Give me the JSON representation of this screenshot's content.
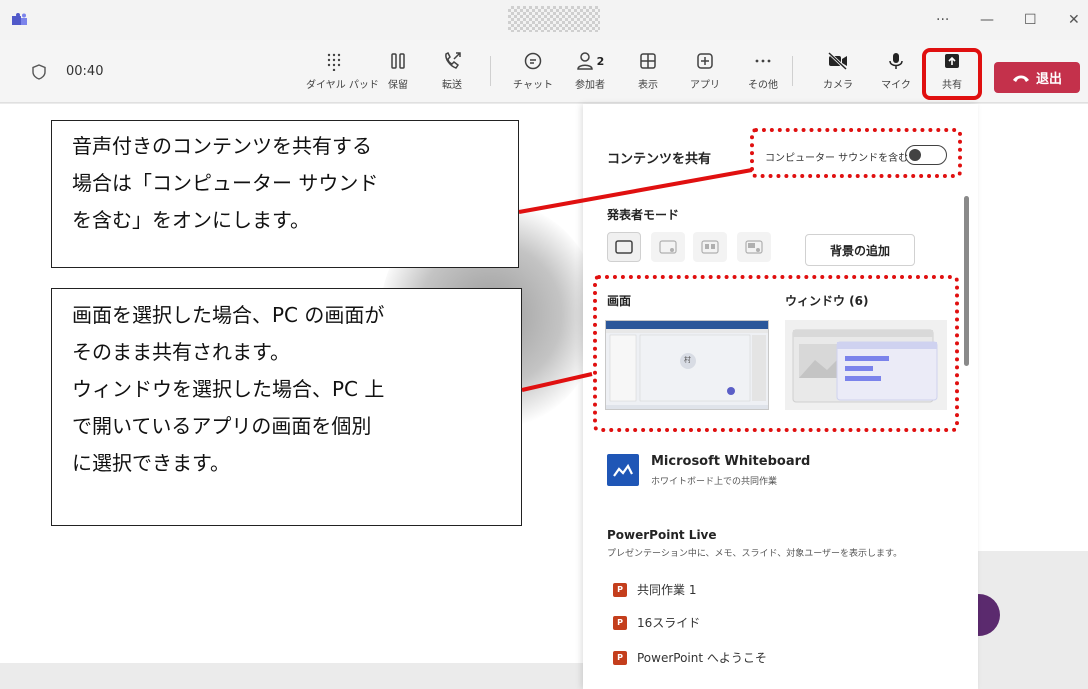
{
  "window": {
    "more_glyph": "···",
    "minimize_glyph": "—",
    "maximize_glyph": "☐",
    "close_glyph": "✕"
  },
  "toolbar": {
    "timer": "00:40",
    "dialpad": "ダイヤル パッド",
    "hold": "保留",
    "transfer": "転送",
    "chat": "チャット",
    "participants": "参加者",
    "participants_count": "2",
    "view": "表示",
    "apps": "アプリ",
    "more": "その他",
    "camera": "カメラ",
    "mic": "マイク",
    "share": "共有",
    "leave": "退出"
  },
  "callouts": {
    "sound": [
      "音声付きのコンテンツを共有する",
      "場合は「コンピューター サウンド",
      "を含む」をオンにします。"
    ],
    "screen": [
      "画面を選択した場合、PC の画面が",
      "そのまま共有されます。",
      "ウィンドウを選択した場合、PC 上",
      "で開いているアプリの画面を個別",
      "に選択できます。"
    ]
  },
  "share_panel": {
    "title": "コンテンツを共有",
    "include_sound": "コンピューター サウンドを含む",
    "include_sound_on": false,
    "presenter_mode": "発表者モード",
    "add_background": "背景の追加",
    "screen": "画面",
    "window": "ウィンドウ (6)",
    "screen_thumb_avatar": "村",
    "whiteboard_title": "Microsoft Whiteboard",
    "whiteboard_sub": "ホワイトボード上での共同作業",
    "ppt_title": "PowerPoint Live",
    "ppt_sub": "プレゼンテーション中に、メモ、スライド、対象ユーザーを表示します。",
    "ppt_files": [
      "共同作業 1",
      "16スライド",
      "PowerPoint へようこそ"
    ]
  },
  "colors": {
    "highlight": "#e01010",
    "leave": "#c4314b",
    "whiteboard": "#1f56b6",
    "ppt": "#c43e1c"
  }
}
